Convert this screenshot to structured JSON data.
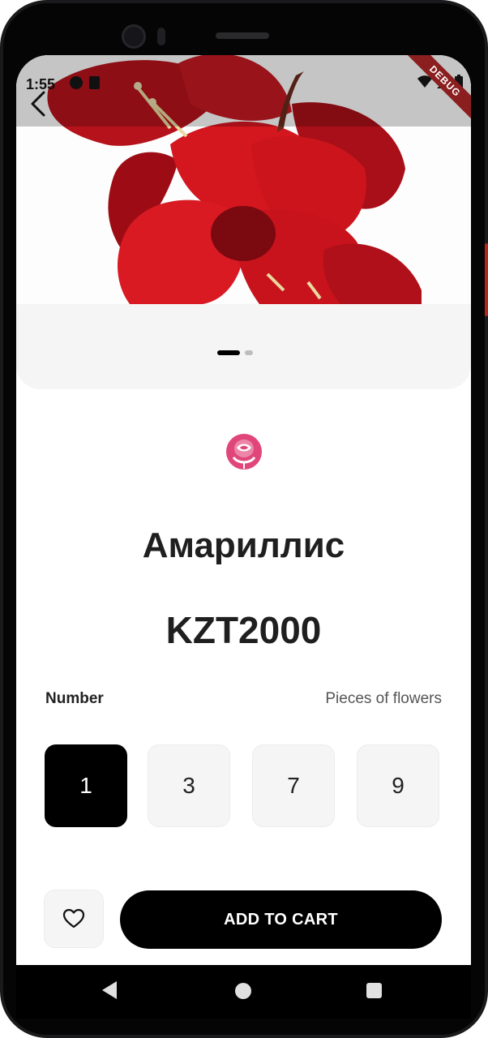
{
  "status_bar": {
    "time": "1:55",
    "debug_label": "DEBUG"
  },
  "hero": {
    "image_alt": "red amaryllis flower",
    "carousel_pages": 2,
    "carousel_active_index": 0
  },
  "product": {
    "logo_icon": "rose-logo-icon",
    "name": "Амариллис",
    "price": "KZT2000"
  },
  "quantity": {
    "label": "Number",
    "unit_label": "Pieces of flowers",
    "options": [
      "1",
      "3",
      "7",
      "9"
    ],
    "selected_index": 0
  },
  "actions": {
    "favorite_icon": "heart-outline-icon",
    "add_to_cart_label": "ADD TO CART"
  },
  "nav": {
    "back_icon": "nav-back-icon",
    "home_icon": "nav-home-icon",
    "recent_icon": "nav-recent-icon"
  },
  "colors": {
    "primary": "#000000",
    "accent_logo": "#e0467a",
    "flower_red": "#c8141c",
    "surface": "#f5f5f5"
  }
}
